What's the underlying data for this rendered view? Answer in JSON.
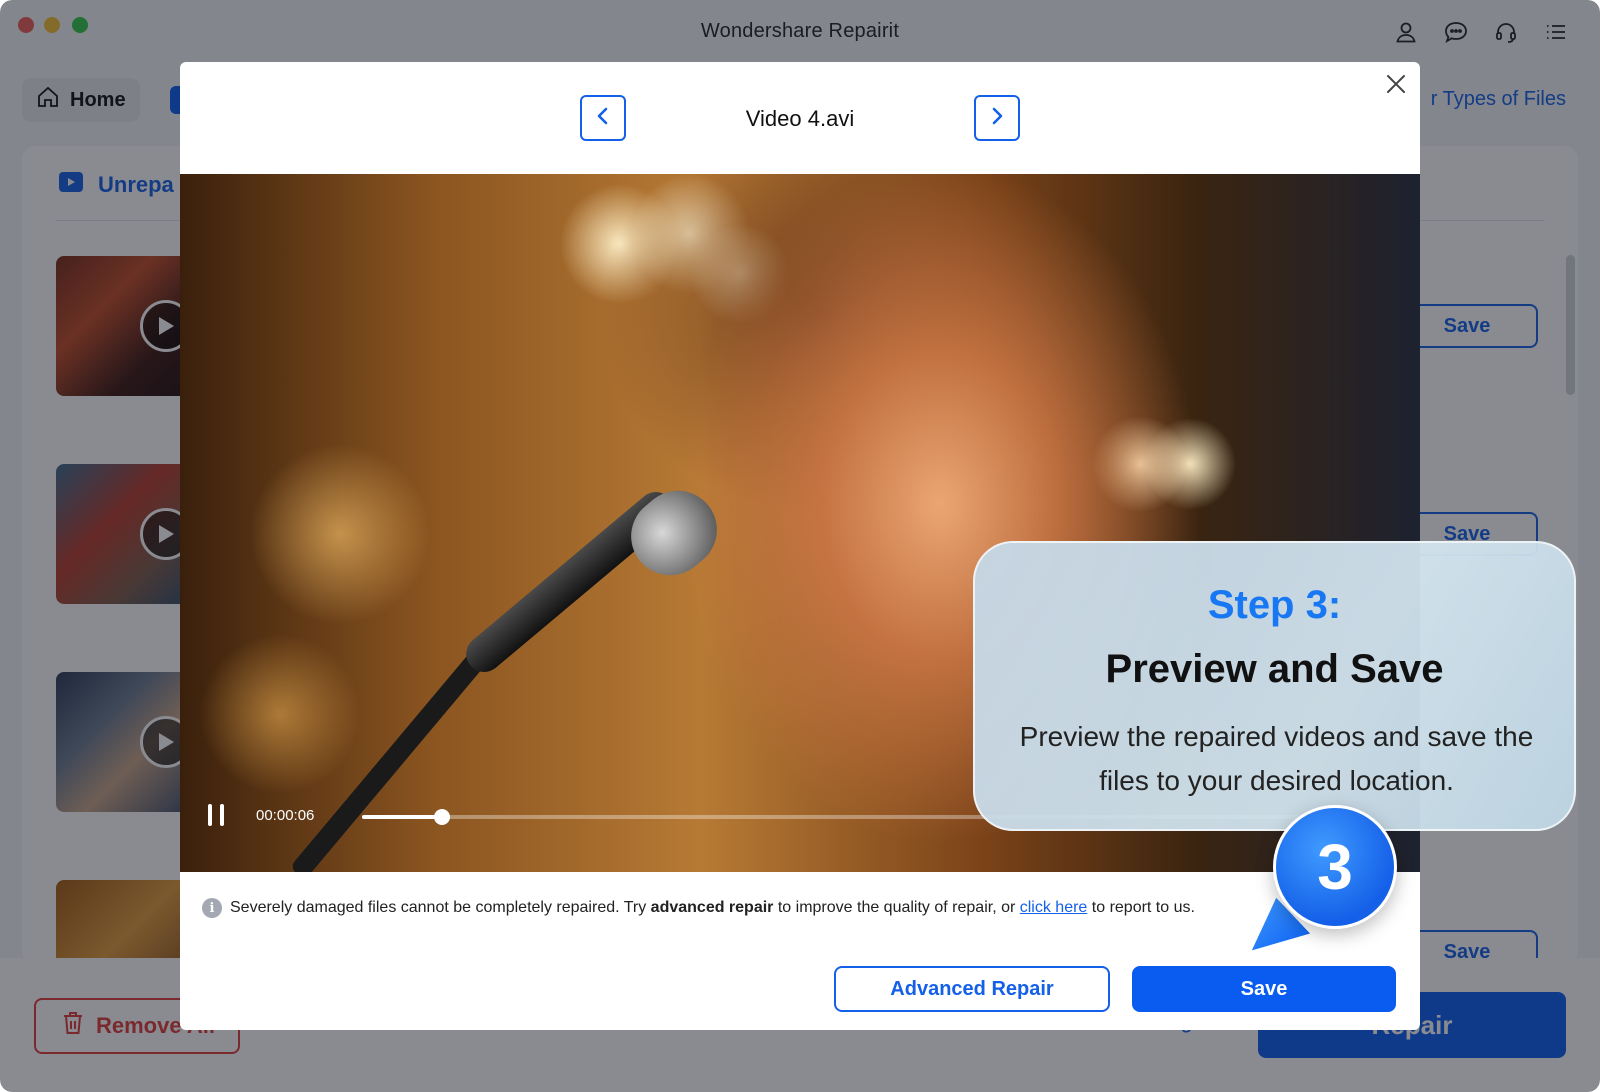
{
  "app": {
    "title": "Wondershare Repairit",
    "home_label": "Home",
    "other_types_label": "r Types of Files",
    "panel_title": "Unrepa",
    "remove_all_label": "Remove All",
    "save_settings_label": "Save Settings",
    "repair_label": "Repair",
    "row_save_label": "Save"
  },
  "modal": {
    "video_title": "Video 4.avi",
    "time": "00:00:06",
    "progress": 0.08,
    "notice_prefix": "Severely damaged files cannot be completely repaired. Try ",
    "notice_bold": "advanced repair",
    "notice_middle": " to improve the quality of repair, or ",
    "notice_link": "click here",
    "notice_suffix": " to report to us.",
    "advanced_repair_label": "Advanced Repair",
    "save_label": "Save"
  },
  "callout": {
    "step": "Step 3:",
    "title": "Preview and Save",
    "description": "Preview the repaired videos and save the files to your desired location.",
    "badge": "3"
  },
  "colors": {
    "accent": "#0a5cf0",
    "link": "#1560e8",
    "danger": "#e03a3a",
    "step": "#1877f2"
  },
  "icons": [
    "home-icon",
    "user-icon",
    "chat-icon",
    "headset-icon",
    "menu-icon",
    "video-file-icon",
    "play-icon",
    "trash-icon",
    "shield-icon",
    "chevron-left-icon",
    "chevron-right-icon",
    "close-icon",
    "pause-icon",
    "info-icon"
  ]
}
